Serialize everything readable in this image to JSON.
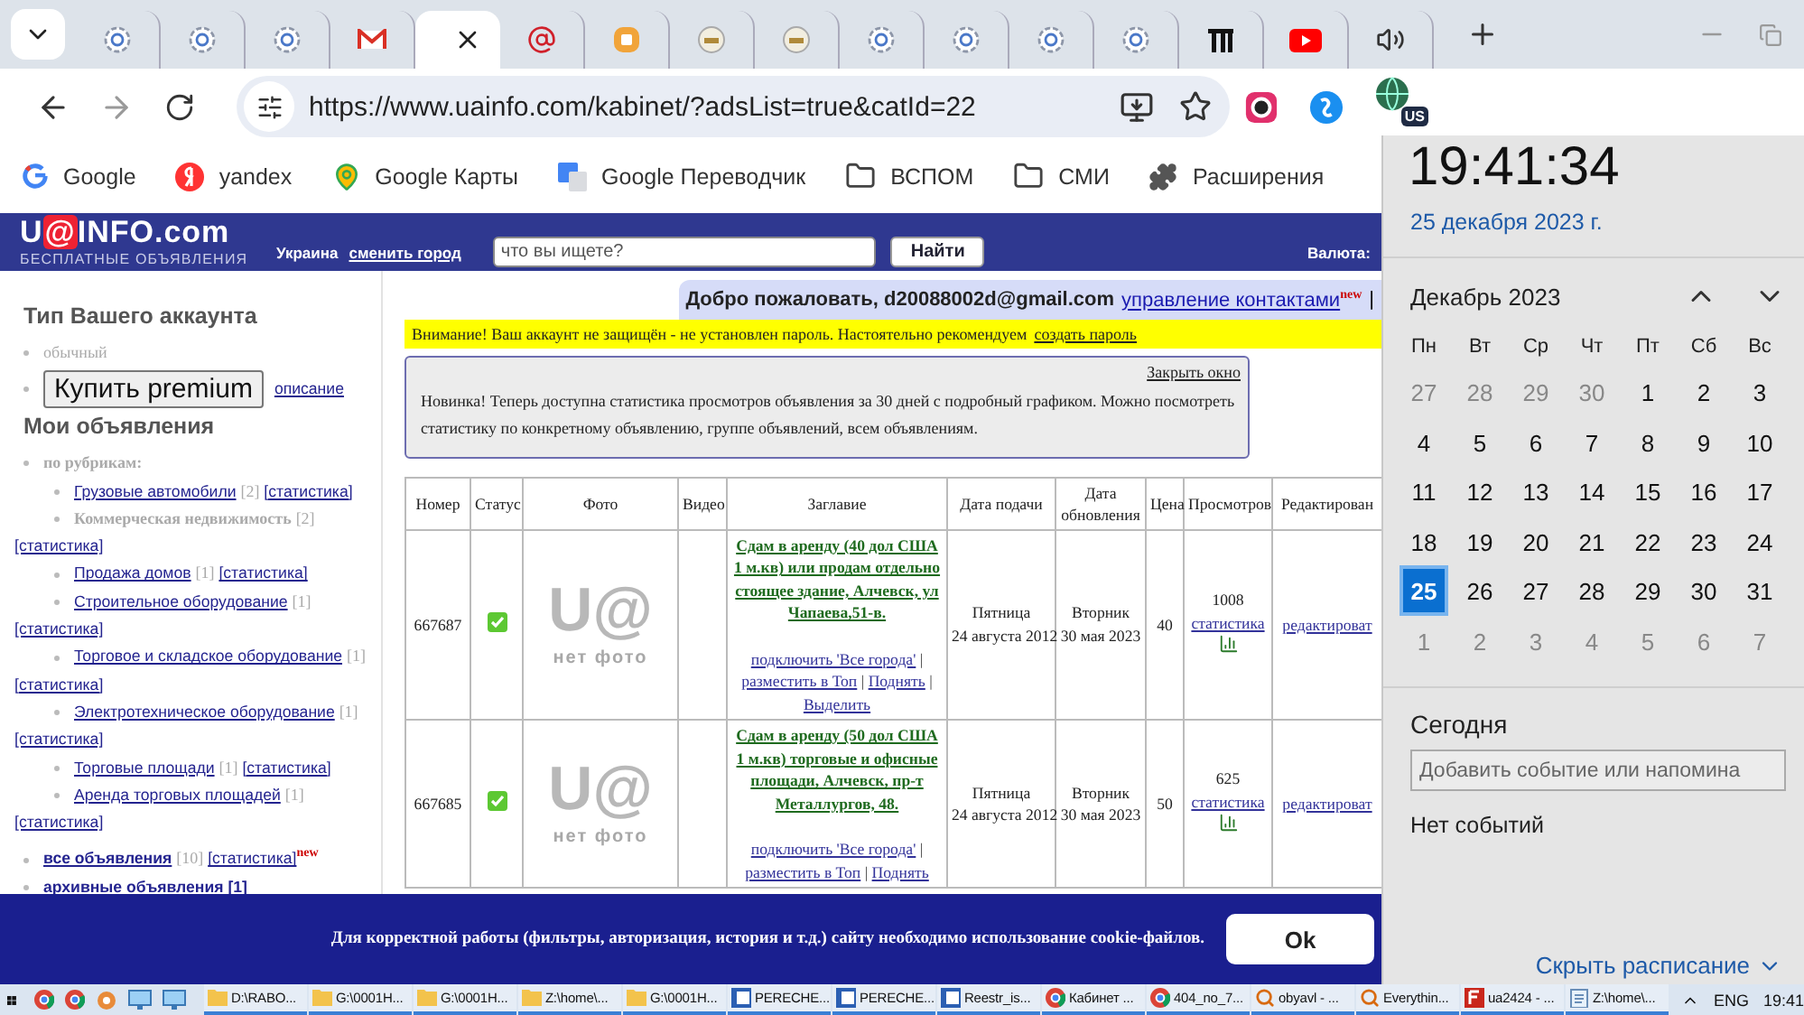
{
  "browser": {
    "tabs": [
      {
        "kind": "ring",
        "selected": false
      },
      {
        "kind": "ring",
        "selected": false
      },
      {
        "kind": "ring",
        "selected": false
      },
      {
        "kind": "mail",
        "selected": false
      },
      {
        "kind": "none",
        "selected": true
      },
      {
        "kind": "at",
        "selected": false
      },
      {
        "kind": "square",
        "selected": false
      },
      {
        "kind": "emblem",
        "selected": false
      },
      {
        "kind": "emblem",
        "selected": false
      },
      {
        "kind": "ring",
        "selected": false
      },
      {
        "kind": "ring",
        "selected": false
      },
      {
        "kind": "ring",
        "selected": false
      },
      {
        "kind": "ring",
        "selected": false
      },
      {
        "kind": "bars",
        "selected": false
      },
      {
        "kind": "play",
        "selected": false
      },
      {
        "kind": "speaker",
        "selected": false
      }
    ],
    "url": "https://www.uainfo.com/kabinet/?adsList=true&catId=22",
    "profile_badge": "US",
    "bookmarks": [
      {
        "kind": "google",
        "label": "Google"
      },
      {
        "kind": "yandex",
        "label": "yandex"
      },
      {
        "kind": "maps",
        "label": "Google Карты"
      },
      {
        "kind": "translate",
        "label": "Google Переводчик"
      },
      {
        "kind": "folder",
        "label": "ВСПОМ"
      },
      {
        "kind": "folder",
        "label": "СМИ"
      },
      {
        "kind": "extensions",
        "label": "Расширения"
      }
    ]
  },
  "site": {
    "logo": {
      "before": "U",
      "mark": "@",
      "after": "INFO.com"
    },
    "tagline": "БЕСПЛАТНЫЕ ОБЪЯВЛЕНИЯ",
    "region": "Украина",
    "change_city": "сменить город",
    "search_placeholder": "что вы ищете?",
    "search_button": "Найти",
    "currency": "Валюта:"
  },
  "sidebar": {
    "account_heading": "Тип Вашего аккаунта",
    "account_type": "обычный",
    "premium_button": "Купить premium",
    "premium_link": "описание",
    "ads_heading": "Мои объявления",
    "groups": [
      {
        "label": "по рубрикам:",
        "children": [
          {
            "name": "Грузовые автомобили",
            "count": "[2]",
            "stats": "[статистика]",
            "linked": true
          },
          {
            "name": "Коммерческая недвижимость",
            "count": "[2]",
            "stats": "[статистика]",
            "linked": false
          },
          {
            "name": "Продажа домов",
            "count": "[1]",
            "stats": "[статистика]",
            "linked": true
          },
          {
            "name": "Строительное оборудование",
            "count": "[1]",
            "stats": "[статистика]",
            "linked": true
          },
          {
            "name": "Торговое и складское оборудование",
            "count": "[1]",
            "stats": "[статистика]",
            "linked": true
          },
          {
            "name": "Электротехническое оборудование",
            "count": "[1]",
            "stats": "[статистика]",
            "linked": true
          },
          {
            "name": "Торговые площади",
            "count": "[1]",
            "stats": "[статистика]",
            "linked": true
          },
          {
            "name": "Аренда торговых площадей",
            "count": "[1]",
            "stats": "[статистика]",
            "linked": true
          }
        ]
      }
    ],
    "all": {
      "label": "все объявления",
      "count": "[10]",
      "stats": "[статистика]",
      "badge": "new"
    },
    "archive": "архивные объявления [1]"
  },
  "main": {
    "welcome": "Добро пожаловать, d20088002d@gmail.com",
    "contacts_link": "управление контактами",
    "contacts_badge": "new",
    "separator": "|",
    "warning": "Внимание! Ваш аккаунт не защищён - не установлен пароль. Настоятельно рекомендуем",
    "warning_link": "создать пароль",
    "notice_close": "Закрыть окно",
    "notice": "Новинка! Теперь доступна статистика просмотров объявления за 30 дней с подробный графиком. Можно посмотреть статистику по конкретному объявлению, группе объявлений, всем объявлениям.",
    "table": {
      "columns": [
        "Номер",
        "Статус",
        "Фото",
        "Видео",
        "Заглавие",
        "Дата подачи",
        "Дата обновления",
        "Цена",
        "Просмотров",
        "Редактирован"
      ],
      "action_separator": "|",
      "rows": [
        {
          "number": "667687",
          "approved": true,
          "photo": {
            "logo": "U@",
            "caption": "нет фото"
          },
          "title": "Сдам в аренду (40 дол США 1 м.кв) или продам отдельно стоящее здание, Алчевск, ул Чапаева,51-в.",
          "actions": [
            "подключить 'Все города'",
            "разместить в Топ",
            "Поднять",
            "Выделить"
          ],
          "submitted": [
            "Пятница",
            "24 августа 2012"
          ],
          "updated": [
            "Вторник",
            "30 мая 2023"
          ],
          "price": "40",
          "views": "1008",
          "stats": "статистика",
          "edit": "редактироват"
        },
        {
          "number": "667685",
          "approved": true,
          "photo": {
            "logo": "U@",
            "caption": "нет фото"
          },
          "title": "Сдам в аренду (50 дол США 1 м.кв) торговые и офисные площади, Алчевск, пр-т Металлургов, 48.",
          "actions": [
            "подключить 'Все города'",
            "разместить в Топ",
            "Поднять"
          ],
          "submitted": [
            "Пятница",
            "24 августа 2012"
          ],
          "updated": [
            "Вторник",
            "30 мая 2023"
          ],
          "price": "50",
          "views": "625",
          "stats": "статистика",
          "edit": "редактироват"
        }
      ]
    }
  },
  "cookie_banner": {
    "text": "Для корректной работы (фильтры, авторизация, история и т.д.) сайту необходимо использование cookie-файлов.",
    "button": "Ok"
  },
  "clock_flyout": {
    "time": "19:41:34",
    "date": "25 декабря 2023 г.",
    "month": "Декабрь 2023",
    "weekdays": [
      "Пн",
      "Вт",
      "Ср",
      "Чт",
      "Пт",
      "Сб",
      "Вс"
    ],
    "weeks": [
      [
        {
          "day": "27",
          "current": false,
          "selected": false
        },
        {
          "day": "28",
          "current": false,
          "selected": false
        },
        {
          "day": "29",
          "current": false,
          "selected": false
        },
        {
          "day": "30",
          "current": false,
          "selected": false
        },
        {
          "day": "1",
          "current": true,
          "selected": false
        },
        {
          "day": "2",
          "current": true,
          "selected": false
        },
        {
          "day": "3",
          "current": true,
          "selected": false
        }
      ],
      [
        {
          "day": "4",
          "current": true,
          "selected": false
        },
        {
          "day": "5",
          "current": true,
          "selected": false
        },
        {
          "day": "6",
          "current": true,
          "selected": false
        },
        {
          "day": "7",
          "current": true,
          "selected": false
        },
        {
          "day": "8",
          "current": true,
          "selected": false
        },
        {
          "day": "9",
          "current": true,
          "selected": false
        },
        {
          "day": "10",
          "current": true,
          "selected": false
        }
      ],
      [
        {
          "day": "11",
          "current": true,
          "selected": false
        },
        {
          "day": "12",
          "current": true,
          "selected": false
        },
        {
          "day": "13",
          "current": true,
          "selected": false
        },
        {
          "day": "14",
          "current": true,
          "selected": false
        },
        {
          "day": "15",
          "current": true,
          "selected": false
        },
        {
          "day": "16",
          "current": true,
          "selected": false
        },
        {
          "day": "17",
          "current": true,
          "selected": false
        }
      ],
      [
        {
          "day": "18",
          "current": true,
          "selected": false
        },
        {
          "day": "19",
          "current": true,
          "selected": false
        },
        {
          "day": "20",
          "current": true,
          "selected": false
        },
        {
          "day": "21",
          "current": true,
          "selected": false
        },
        {
          "day": "22",
          "current": true,
          "selected": false
        },
        {
          "day": "23",
          "current": true,
          "selected": false
        },
        {
          "day": "24",
          "current": true,
          "selected": false
        }
      ],
      [
        {
          "day": "25",
          "current": true,
          "selected": true
        },
        {
          "day": "26",
          "current": true,
          "selected": false
        },
        {
          "day": "27",
          "current": true,
          "selected": false
        },
        {
          "day": "28",
          "current": true,
          "selected": false
        },
        {
          "day": "29",
          "current": true,
          "selected": false
        },
        {
          "day": "30",
          "current": true,
          "selected": false
        },
        {
          "day": "31",
          "current": true,
          "selected": false
        }
      ],
      [
        {
          "day": "1",
          "current": false,
          "selected": false
        },
        {
          "day": "2",
          "current": false,
          "selected": false
        },
        {
          "day": "3",
          "current": false,
          "selected": false
        },
        {
          "day": "4",
          "current": false,
          "selected": false
        },
        {
          "day": "5",
          "current": false,
          "selected": false
        },
        {
          "day": "6",
          "current": false,
          "selected": false
        },
        {
          "day": "7",
          "current": false,
          "selected": false
        }
      ]
    ],
    "today": "Сегодня",
    "event_placeholder": "Добавить событие или напомина",
    "no_events": "Нет событий",
    "hide_schedule": "Скрыть расписание"
  },
  "taskbar": {
    "pinned": [
      {
        "kind": "browser"
      },
      {
        "kind": "browser"
      },
      {
        "kind": "gear"
      },
      {
        "kind": "monitor"
      },
      {
        "kind": "monitor"
      }
    ],
    "items": [
      {
        "kind": "folder",
        "label": "D:\\RABO..."
      },
      {
        "kind": "folder",
        "label": "G:\\0001H..."
      },
      {
        "kind": "folder",
        "label": "G:\\0001H..."
      },
      {
        "kind": "folder",
        "label": "Z:\\home\\..."
      },
      {
        "kind": "folder",
        "label": "G:\\0001H..."
      },
      {
        "kind": "doc",
        "label": "PERECHE..."
      },
      {
        "kind": "doc",
        "label": "PERECHE..."
      },
      {
        "kind": "doc",
        "label": "Reestr_is..."
      },
      {
        "kind": "browser",
        "label": "Кабинет ..."
      },
      {
        "kind": "browser",
        "label": "404_no_7..."
      },
      {
        "kind": "tool",
        "label": "obyavl - ..."
      },
      {
        "kind": "tool",
        "label": "Everythin..."
      },
      {
        "kind": "ftp",
        "label": "ua2424 - ..."
      },
      {
        "kind": "note",
        "label": "Z:\\home\\..."
      }
    ],
    "language": "ENG",
    "time": "19:41"
  }
}
